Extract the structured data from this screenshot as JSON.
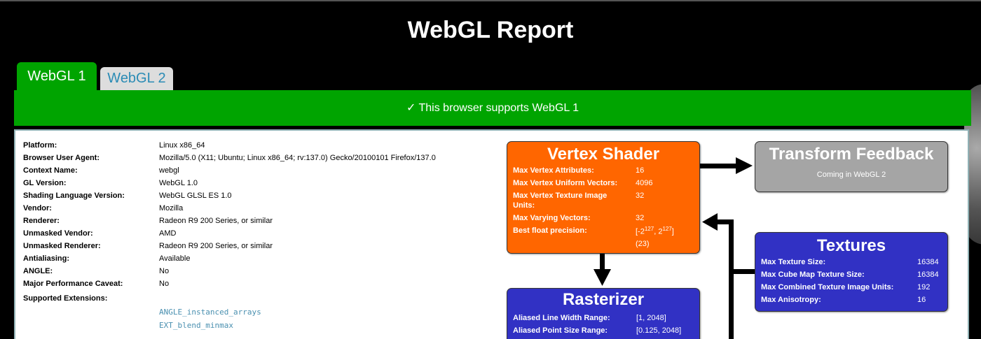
{
  "title": "WebGL Report",
  "tabs": [
    {
      "label": "WebGL 1"
    },
    {
      "label": "WebGL 2"
    }
  ],
  "banner": "✓ This browser supports WebGL 1",
  "info": [
    {
      "key": "Platform:",
      "value": "Linux x86_64"
    },
    {
      "key": "Browser User Agent:",
      "value": "Mozilla/5.0 (X11; Ubuntu; Linux x86_64; rv:137.0) Gecko/20100101 Firefox/137.0"
    },
    {
      "key": "Context Name:",
      "value": "webgl"
    },
    {
      "key": "GL Version:",
      "value": "WebGL 1.0"
    },
    {
      "key": "Shading Language Version:",
      "value": "WebGL GLSL ES 1.0"
    },
    {
      "key": "Vendor:",
      "value": "Mozilla"
    },
    {
      "key": "Renderer:",
      "value": "Radeon R9 200 Series, or similar"
    },
    {
      "key": "Unmasked Vendor:",
      "value": "AMD"
    },
    {
      "key": "Unmasked Renderer:",
      "value": "Radeon R9 200 Series, or similar"
    },
    {
      "key": "Antialiasing:",
      "value": "Available"
    },
    {
      "key": "ANGLE:",
      "value": "No"
    },
    {
      "key": "Major Performance Caveat:",
      "value": "No"
    }
  ],
  "extensions_label": "Supported Extensions:",
  "extensions": [
    "ANGLE_instanced_arrays",
    "EXT_blend_minmax"
  ],
  "vertex_shader": {
    "title": "Vertex Shader",
    "rows": [
      {
        "key": "Max Vertex Attributes:",
        "value": "16"
      },
      {
        "key": "Max Vertex Uniform Vectors:",
        "value": "4096"
      },
      {
        "key": "Max Vertex Texture Image",
        "key2": "Units:",
        "value": "32"
      },
      {
        "key": "Max Varying Vectors:",
        "value": "32"
      },
      {
        "key": "Best float precision:",
        "value_pre": "[-2",
        "sup1": "127",
        "value_mid": ", 2",
        "sup2": "127",
        "value_post": "]",
        "value_line2": "(23)"
      }
    ]
  },
  "transform_feedback": {
    "title": "Transform Feedback",
    "subtitle": "Coming in WebGL 2"
  },
  "textures": {
    "title": "Textures",
    "rows": [
      {
        "key": "Max Texture Size:",
        "value": "16384"
      },
      {
        "key": "Max Cube Map Texture Size:",
        "value": "16384"
      },
      {
        "key": "Max Combined Texture Image Units:",
        "value": "192"
      },
      {
        "key": "Max Anisotropy:",
        "value": "16"
      }
    ]
  },
  "rasterizer": {
    "title": "Rasterizer",
    "rows": [
      {
        "key": "Aliased Line Width Range:",
        "value": "[1, 2048]"
      },
      {
        "key": "Aliased Point Size Range:",
        "value": "[0.125, 2048]"
      }
    ]
  },
  "colors": {
    "vertex_shader": "#ff6600",
    "transform_feedback": "#a5a5a5",
    "textures": "#3131c4",
    "rasterizer": "#3131c4",
    "banner": "#00a400",
    "tab_inactive_text": "#2a8bb5"
  }
}
